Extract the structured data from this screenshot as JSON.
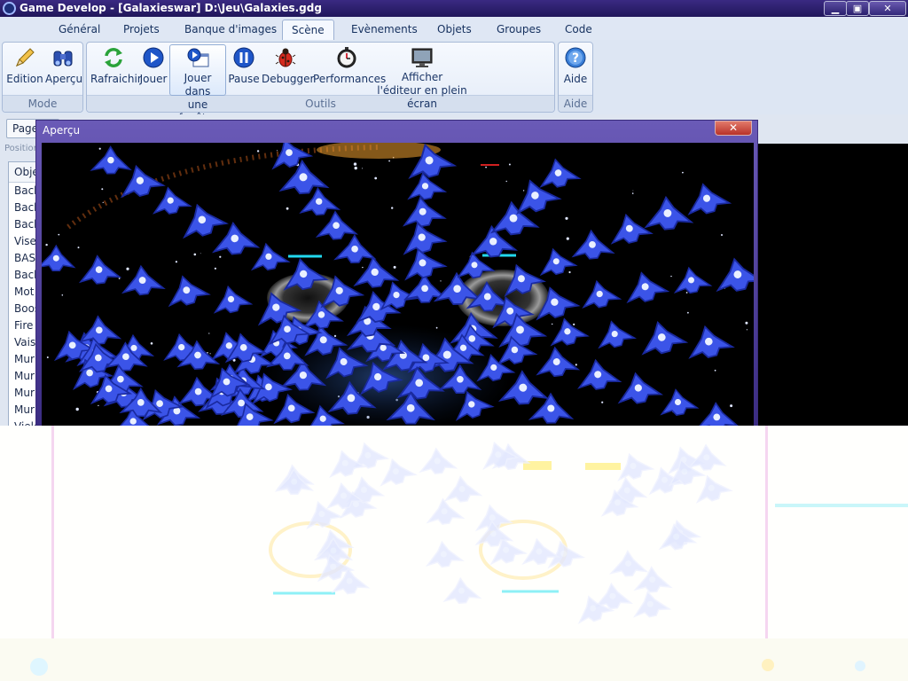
{
  "window": {
    "title": "Game Develop - [Galaxieswar] D:\\Jeu\\Galaxies.gdg",
    "min_glyph": "▁",
    "max_glyph": "▣",
    "close_glyph": "✕"
  },
  "menu_tabs": [
    {
      "label": "Général"
    },
    {
      "label": "Projets"
    },
    {
      "label": "Banque d'images"
    },
    {
      "label": "Scène",
      "active": true
    },
    {
      "label": "Evènements"
    },
    {
      "label": "Objets"
    },
    {
      "label": "Groupes"
    },
    {
      "label": "Code"
    }
  ],
  "ribbon": {
    "mode": {
      "label": "Mode",
      "buttons": [
        {
          "label": "Edition",
          "icon": "pencil-icon"
        },
        {
          "label": "Aperçu",
          "icon": "binoculars-icon"
        }
      ]
    },
    "outils": {
      "label": "Outils",
      "buttons": [
        {
          "label": "Rafraichir",
          "icon": "refresh-icon"
        },
        {
          "label": "Jouer",
          "icon": "play-icon"
        },
        {
          "label": "Jouer dans",
          "label2": "une fenêtre",
          "icon": "play-window-icon",
          "selected": true
        },
        {
          "label": "Pause",
          "icon": "pause-icon"
        },
        {
          "label": "Debugger",
          "icon": "bug-icon"
        },
        {
          "label": "Performances",
          "icon": "stopwatch-icon"
        },
        {
          "label": "Afficher",
          "label2": "l'éditeur en plein écran",
          "icon": "monitor-icon"
        }
      ]
    },
    "aide": {
      "label": "Aide",
      "buttons": [
        {
          "label": "Aide",
          "icon": "help-icon"
        }
      ]
    }
  },
  "editor": {
    "page_button": "Page",
    "position_label": "Position",
    "objects_header": "Obje",
    "objects": [
      "Back",
      "Back",
      "Back",
      "Viser",
      "BASI",
      "Back",
      "Mot",
      "Boos",
      "Fire",
      "Vaiss",
      "Mur",
      "Mur",
      "Mur",
      "Mur",
      "Viele"
    ]
  },
  "preview": {
    "title": "Aperçu",
    "close_glyph": "✕"
  },
  "colors": {
    "titlebar": "#2a1f6e",
    "preview_frame": "#5b4aa8",
    "ship_blue": "#3b54e8",
    "health_cyan": "#22d8ee"
  }
}
